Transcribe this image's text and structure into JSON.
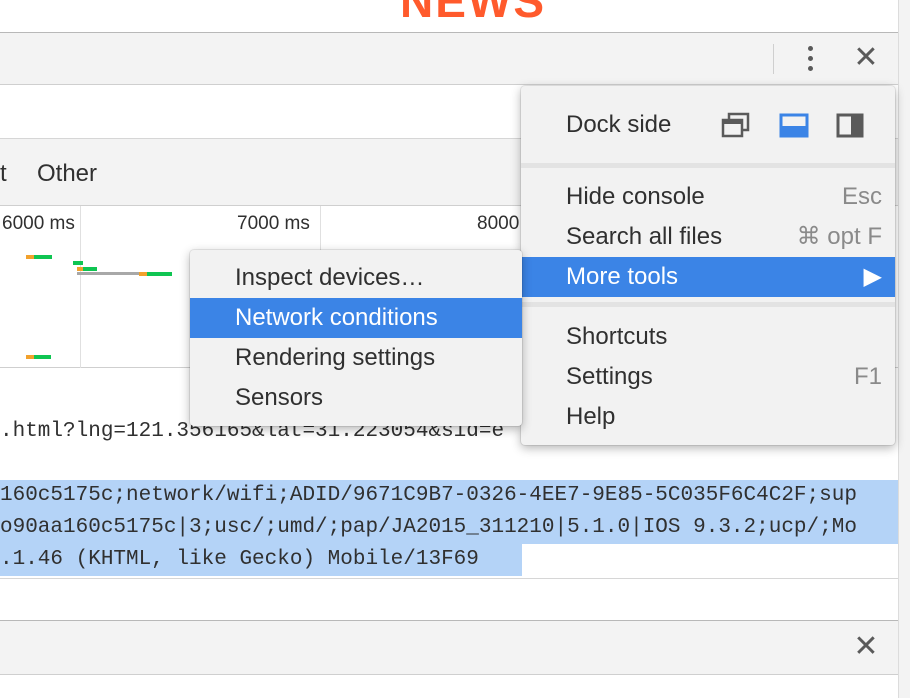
{
  "page": {
    "brand_fragment": "NEWS"
  },
  "devtools": {
    "close_glyph": "✕",
    "type_filters": [
      {
        "label": "t"
      },
      {
        "label": "Other"
      }
    ],
    "timeline_ticks": [
      "6000 ms",
      "7000 ms",
      "8000"
    ],
    "request_url_fragment": ".html?lng=121.356165&lat=31.223054&sid=e",
    "user_agent_lines": [
      "160c5175c;network/wifi;ADID/9671C9B7-0326-4EE7-9E85-5C035F6C4C2F;sup",
      "o90aa160c5175c|3;usc/;umd/;pap/JA2015_311210|5.1.0|IOS 9.3.2;ucp/;Mo",
      ".1.46 (KHTML, like Gecko) Mobile/13F69"
    ],
    "colors": {
      "bar_green": "#0fc552",
      "bar_orange": "#f2a12c",
      "bar_gray": "#a8a8a8",
      "highlight": "#3b84e6",
      "selection": "#b4d3f7"
    }
  },
  "main_menu": {
    "dock_side_label": "Dock side",
    "dock_icons": [
      "undock-icon",
      "dock-bottom-icon",
      "dock-right-icon"
    ],
    "items": [
      {
        "label": "Hide console",
        "shortcut": "Esc"
      },
      {
        "label": "Search all files",
        "shortcut": "⌘ opt F"
      },
      {
        "label": "More tools",
        "shortcut": "▶"
      },
      {
        "label": "Shortcuts",
        "shortcut": ""
      },
      {
        "label": "Settings",
        "shortcut": "F1"
      },
      {
        "label": "Help",
        "shortcut": ""
      }
    ]
  },
  "more_tools_menu": {
    "items": [
      {
        "label": "Inspect devices…"
      },
      {
        "label": "Network conditions"
      },
      {
        "label": "Rendering settings"
      },
      {
        "label": "Sensors"
      }
    ]
  }
}
